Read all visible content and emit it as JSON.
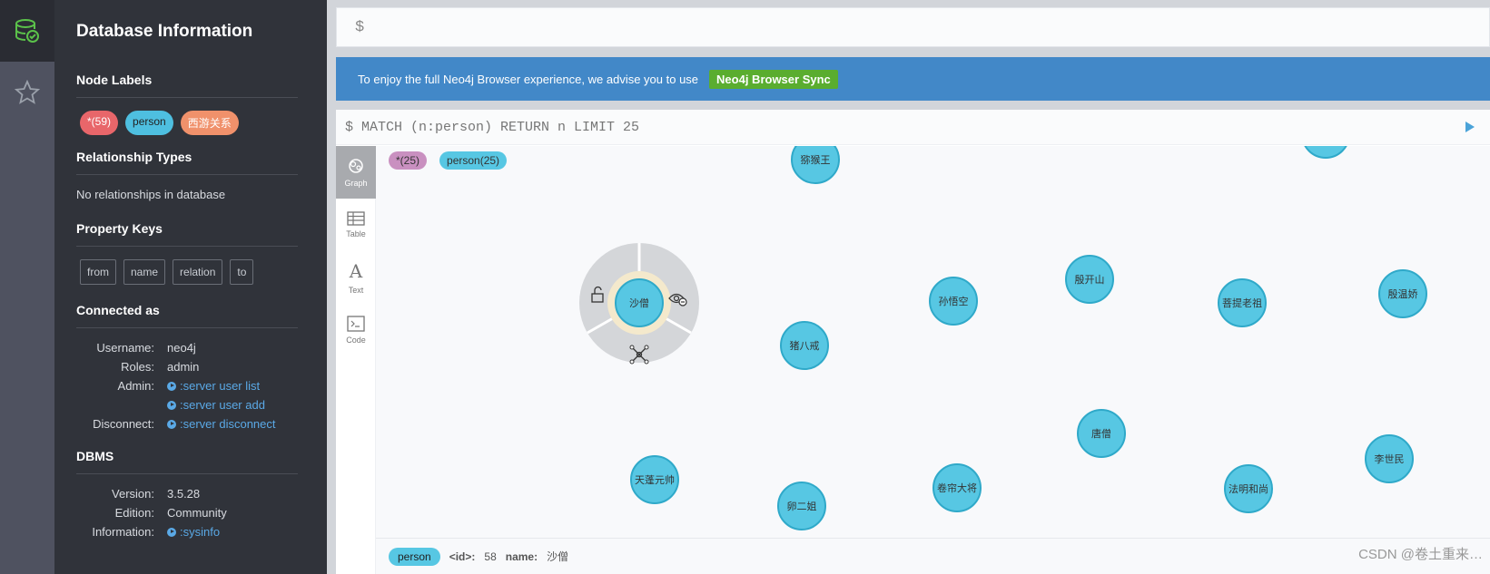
{
  "drawer": {
    "title": "Database Information",
    "node_labels_heading": "Node Labels",
    "node_labels": [
      {
        "text": "*(59)",
        "color": "#e8666a"
      },
      {
        "text": "person",
        "color": "#4ebfe0"
      },
      {
        "text": "西游关系",
        "color": "#f0916b"
      }
    ],
    "rel_heading": "Relationship Types",
    "rel_text": "No relationships in database",
    "prop_heading": "Property Keys",
    "prop_keys": [
      "from",
      "name",
      "relation",
      "to"
    ],
    "connected_heading": "Connected as",
    "username_label": "Username:",
    "username": "neo4j",
    "roles_label": "Roles:",
    "roles": "admin",
    "admin_label": "Admin:",
    "admin_link1": ":server user list",
    "admin_link2": ":server user add",
    "disconnect_label": "Disconnect:",
    "disconnect_link": ":server disconnect",
    "dbms_heading": "DBMS",
    "version_label": "Version:",
    "version": "3.5.28",
    "edition_label": "Edition:",
    "edition": "Community",
    "information_label": "Information:",
    "information_link": ":sysinfo"
  },
  "editor": {
    "prompt": "$"
  },
  "banner": {
    "text": "To enjoy the full Neo4j Browser experience, we advise you to use",
    "button": "Neo4j Browser Sync"
  },
  "frame": {
    "query": "$ MATCH (n:person) RETURN n LIMIT 25",
    "views": [
      "Graph",
      "Table",
      "Text",
      "Code"
    ],
    "labels": [
      {
        "text": "*(25)",
        "color": "#c990c0"
      },
      {
        "text": "person(25)",
        "color": "#57c7e3"
      }
    ],
    "nodes": [
      "猕猴王",
      "沙僧",
      "孙悟空",
      "殷开山",
      "菩提老祖",
      "殷温娇",
      "猪八戒",
      "唐僧",
      "天蓬元帅",
      "卵二姐",
      "卷帘大将",
      "法明和尚",
      "李世民"
    ],
    "status": {
      "tag": "person",
      "id_label": "<id>:",
      "id": "58",
      "name_label": "name:",
      "name": "沙僧"
    }
  },
  "watermark": "CSDN @卷土重来…"
}
